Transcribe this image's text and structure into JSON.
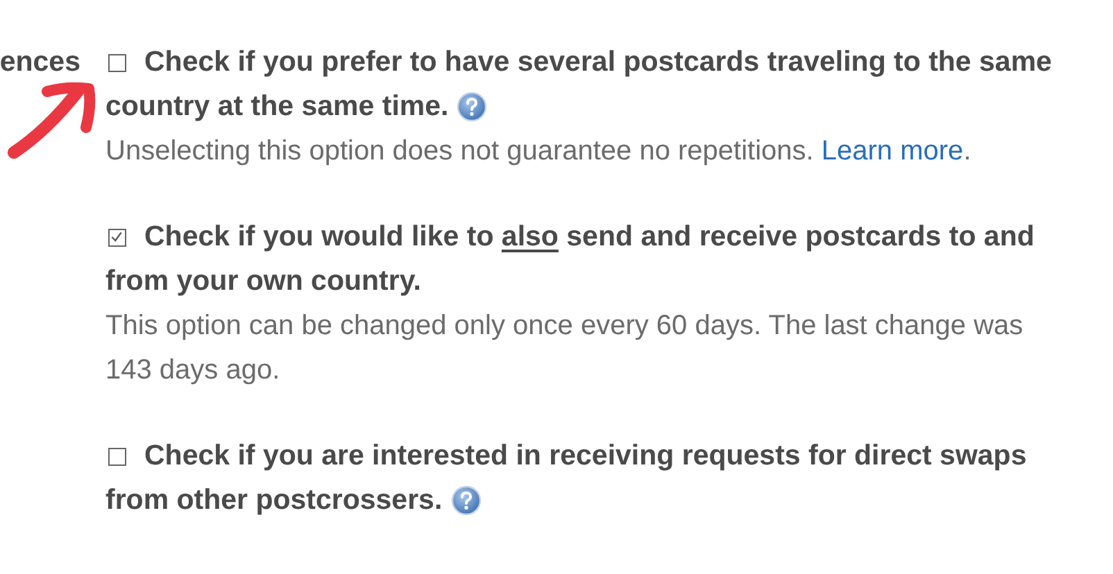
{
  "section_label": "ences",
  "options": [
    {
      "checked": false,
      "help": true,
      "label_lines": [
        {
          "parts": [
            {
              "text": "Check if you prefer to have several postcards traveling to the same",
              "underline": false
            }
          ]
        },
        {
          "parts": [
            {
              "text": "country at the same time.",
              "underline": false
            }
          ]
        }
      ],
      "note": [
        {
          "text": "Unselecting this option does not guarantee no repetitions. ",
          "link": false
        },
        {
          "text": "Learn more",
          "link": true
        },
        {
          "text": ".",
          "link": false
        }
      ]
    },
    {
      "checked": true,
      "help": false,
      "label_lines": [
        {
          "parts": [
            {
              "text": "Check if you would like to ",
              "underline": false
            },
            {
              "text": "also",
              "underline": true
            },
            {
              "text": " send and receive postcards to and",
              "underline": false
            }
          ]
        },
        {
          "parts": [
            {
              "text": "from your own country.",
              "underline": false
            }
          ]
        }
      ],
      "note": [
        {
          "text": "This option can be changed only once every 60 days. The last change was 143 days ago.",
          "link": false
        }
      ]
    },
    {
      "checked": false,
      "help": true,
      "label_lines": [
        {
          "parts": [
            {
              "text": "Check if you are interested in receiving requests for direct swaps",
              "underline": false
            }
          ]
        },
        {
          "parts": [
            {
              "text": "from other postcrossers.",
              "underline": false
            }
          ]
        }
      ]
    }
  ]
}
